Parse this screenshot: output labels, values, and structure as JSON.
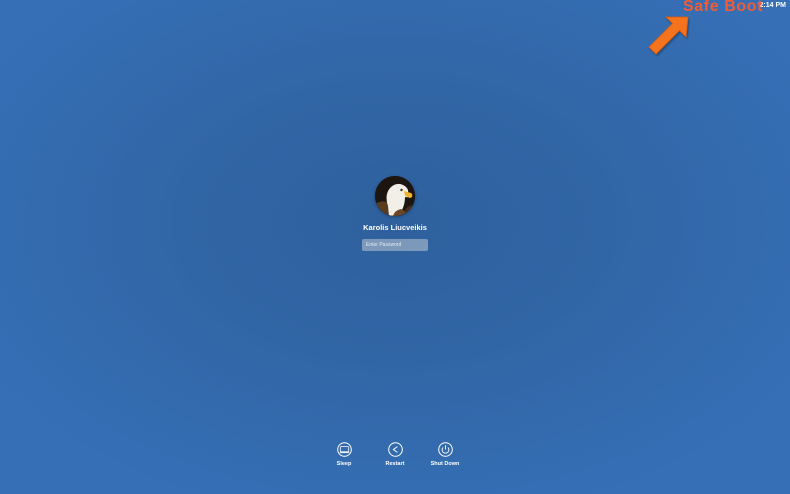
{
  "menu_bar": {
    "time": "2:14 PM"
  },
  "annotation": {
    "label": "Safe Boot",
    "color": "#f25c35",
    "arrow_icon": "arrow-icon"
  },
  "login": {
    "user_name": "Karolis Liucveikis",
    "avatar_icon": "eagle-avatar-icon",
    "password": {
      "value": "",
      "placeholder": "Enter Password"
    }
  },
  "power_actions": [
    {
      "label": "Sleep",
      "icon": "sleep-icon"
    },
    {
      "label": "Restart",
      "icon": "restart-icon"
    },
    {
      "label": "Shut Down",
      "icon": "power-icon"
    }
  ],
  "colors": {
    "background": "#3166a6",
    "text": "#ffffff"
  }
}
